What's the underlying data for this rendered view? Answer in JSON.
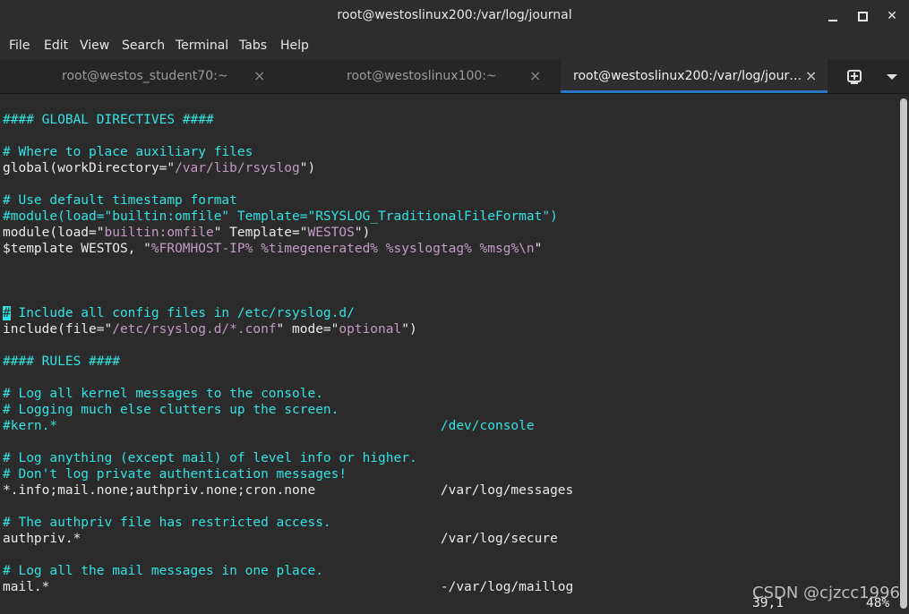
{
  "window": {
    "title": "root@westoslinux200:/var/log/journal",
    "minimize_icon": "minimize-icon",
    "maximize_icon": "maximize-icon",
    "close_glyph": "✕"
  },
  "menu": {
    "items": [
      "File",
      "Edit",
      "View",
      "Search",
      "Terminal",
      "Tabs",
      "Help"
    ]
  },
  "tabs": [
    {
      "label": "root@westos_student70:~",
      "close": "×",
      "active": false
    },
    {
      "label": "root@westoslinux100:~",
      "close": "×",
      "active": false
    },
    {
      "label": "root@westoslinux200:/var/log/jour…",
      "close": "×",
      "active": true
    }
  ],
  "tab_actions": {
    "new_tab_icon": "new-tab-icon",
    "menu_icon": "tab-menu-icon"
  },
  "colors": {
    "comment": "#34e2e2",
    "string": "#c19bc4",
    "text": "#ebebeb",
    "background": "#2b2b2b",
    "tab_accent": "#2a76c6"
  },
  "editor": {
    "lines": [
      "#### GLOBAL DIRECTIVES ####",
      "",
      "# Where to place auxiliary files",
      "global(workDirectory=\"/var/lib/rsyslog\")",
      "",
      "# Use default timestamp format",
      "#module(load=\"builtin:omfile\" Template=\"RSYSLOG_TraditionalFileFormat\")",
      "module(load=\"builtin:omfile\" Template=\"WESTOS\")",
      "$template WESTOS, \"%FROMHOST-IP% %timegenerated% %syslogtag% %msg%\\n\"",
      "",
      "",
      "",
      "# Include all config files in /etc/rsyslog.d/",
      "include(file=\"/etc/rsyslog.d/*.conf\" mode=\"optional\")",
      "",
      "#### RULES ####",
      "",
      "# Log all kernel messages to the console.",
      "# Logging much else clutters up the screen.",
      "#kern.*                                                 /dev/console",
      "",
      "# Log anything (except mail) of level info or higher.",
      "# Don't log private authentication messages!",
      "*.info;mail.none;authpriv.none;cron.none                /var/log/messages",
      "",
      "# The authpriv file has restricted access.",
      "authpriv.*                                              /var/log/secure",
      "",
      "# Log all the mail messages in one place.",
      "mail.*                                                  -/var/log/maillog"
    ],
    "status_position": "39,1",
    "status_percent": "48%"
  },
  "watermark": "CSDN @cjzcc1996"
}
